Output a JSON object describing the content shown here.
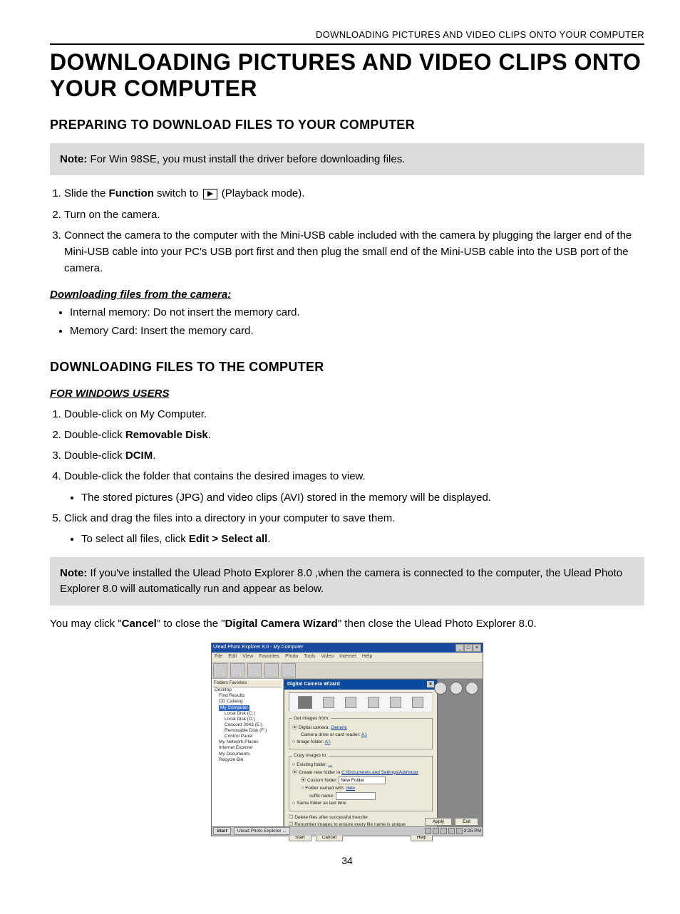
{
  "header_line": "DOWNLOADING PICTURES AND VIDEO CLIPS ONTO YOUR COMPUTER",
  "title": "DOWNLOADING PICTURES AND VIDEO CLIPS ONTO YOUR COMPUTER",
  "section_a": {
    "heading": "PREPARING TO DOWNLOAD FILES TO YOUR COMPUTER",
    "note_label": "Note:",
    "note_text": " For Win 98SE, you must install the driver before downloading files.",
    "step1_a": "Slide the ",
    "step1_bold": "Function",
    "step1_b": " switch to ",
    "step1_c": " (Playback mode).",
    "step2": "Turn on the camera.",
    "step3": "Connect the camera to the computer with the Mini-USB cable included with the camera by plugging the larger end of the Mini-USB cable into your PC's USB port first and then plug the small end of the Mini-USB cable into the USB port of the camera.",
    "sub_heading": "Downloading files from the camera:",
    "bul1": "Internal memory: Do not insert the memory card.",
    "bul2": "Memory Card: Insert the memory card."
  },
  "section_b": {
    "heading": "DOWNLOADING FILES TO THE COMPUTER",
    "sub_heading": "FOR WINDOWS USERS",
    "step1": "Double-click on My Computer.",
    "step2_a": "Double-click ",
    "step2_bold": "Removable Disk",
    "step2_b": ".",
    "step3_a": "Double-click ",
    "step3_bold": "DCIM",
    "step3_b": ".",
    "step4": "Double-click the folder that contains the desired images to view.",
    "step4_sub": "The stored pictures (JPG) and video clips (AVI) stored in the memory will be displayed.",
    "step5": "Click and drag the files into a directory in your computer to save them.",
    "step5_sub_a": "To select all files, click ",
    "step5_sub_bold": "Edit > Select all",
    "step5_sub_b": ".",
    "note_label": "Note:",
    "note_text": "  If you've installed the Ulead Photo Explorer 8.0 ,when the camera is connected to the computer, the Ulead Photo Explorer 8.0 will automatically run and appear as below.",
    "closing_a": "You may click \"",
    "closing_bold1": "Cancel",
    "closing_b": "\" to close the \"",
    "closing_bold2": "Digital Camera Wizard",
    "closing_c": "\" then close the Ulead Photo Explorer 8.0."
  },
  "screenshot": {
    "titlebar": "Ulead Photo Explorer 8.0 - My Computer",
    "menus": [
      "File",
      "Edit",
      "View",
      "Favorites",
      "Photo",
      "Tools",
      "Video",
      "Internet",
      "Help"
    ],
    "tabs_label": "Folders   Favorites   ",
    "tree": {
      "desktop": "Desktop",
      "find": "Find Results",
      "cd": "CD Catalog",
      "mycomp": "My Computer",
      "c": "Local Disk (C:)",
      "d": "Local Disk (D:)",
      "e": "Concord 3043 (E:)",
      "f": "Removable Disk (F:)",
      "cp": "Control Panel",
      "net": "My Network Places",
      "ie": "Internet Explorer",
      "docs": "My Documents",
      "rec": "Recycle Bin"
    },
    "wizard": {
      "title": "Digital Camera Wizard",
      "group1": "Get images from:",
      "opt1a": "Digital camera:",
      "opt1a_link": "Generic",
      "opt1b": "Camera drive or card reader:",
      "opt1b_link": "A:\\",
      "opt1c": "Image folder:",
      "opt1c_link": "A:\\",
      "group2": "Copy images to:",
      "opt2a": "Existing folder:",
      "opt2a_link": "...",
      "opt2b": "Create new folder in",
      "opt2b_link": "C:\\Documents and Settings\\Administr",
      "opt2c": "Custom folder:",
      "opt2c_val": "New Folder",
      "opt2d": "Folder named with:",
      "opt2d_link": "date",
      "suffix_label": "suffix name:",
      "opt2e": "Same folder as last time",
      "chk1": "Delete files after successful transfer",
      "chk2": "Renumber images to ensure every file name is unique",
      "btn_start": "Start",
      "btn_cancel": "Cancel",
      "btn_help": "Help"
    },
    "right_buttons": {
      "apply": "Apply",
      "exit": "Exit"
    },
    "taskbar": {
      "start": "Start",
      "task": "Ulead Photo Explorer ...",
      "time": "3:25 PM"
    }
  },
  "page_number": "34"
}
